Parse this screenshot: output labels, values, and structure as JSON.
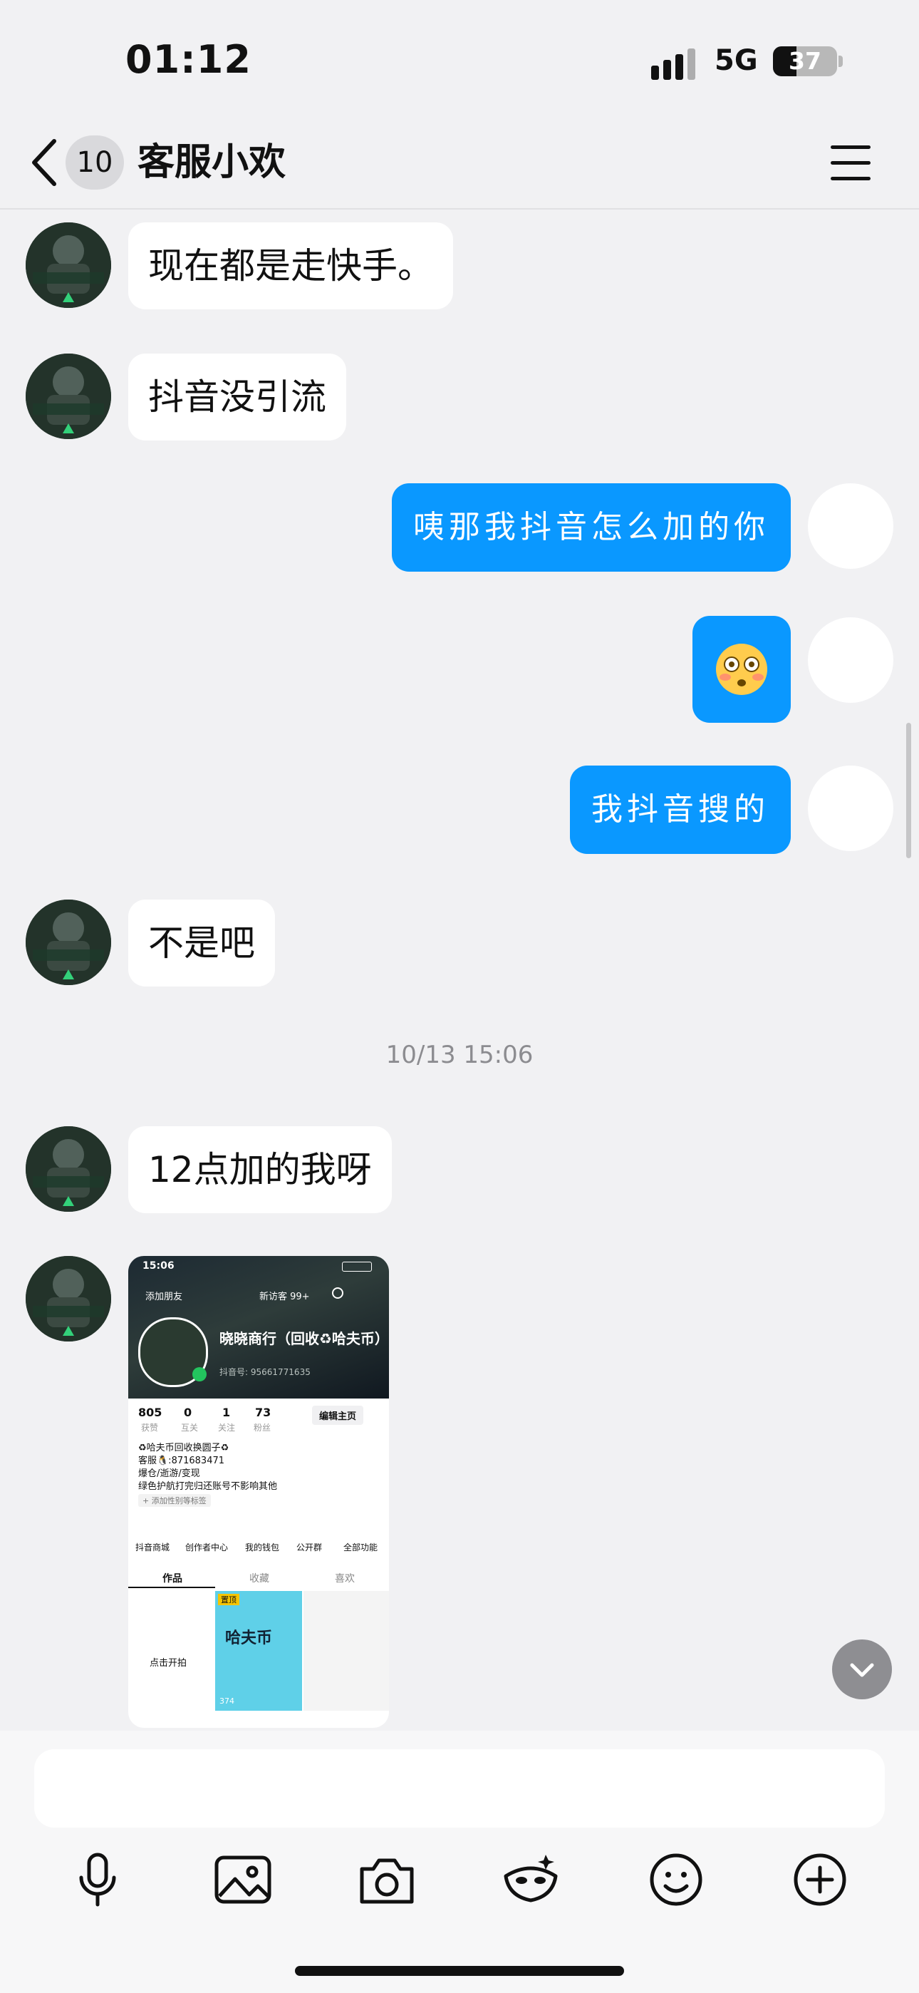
{
  "status_bar": {
    "time": "01:12",
    "network": "5G",
    "battery": "37",
    "battery_fraction": 0.37
  },
  "header": {
    "unread_count": "10",
    "title": "客服小欢"
  },
  "messages": [
    {
      "side": "in",
      "text": "现在都是走快手。"
    },
    {
      "side": "in",
      "text": "抖音没引流"
    },
    {
      "side": "out",
      "text": "咦那我抖音怎么加的你"
    },
    {
      "side": "out",
      "emoji": "😳"
    },
    {
      "side": "out",
      "text": "我抖音搜的"
    },
    {
      "side": "in",
      "text": "不是吧"
    },
    {
      "timestamp": "10/13 15:06"
    },
    {
      "side": "in",
      "text": "12点加的我呀"
    }
  ],
  "shared_screenshot": {
    "time": "15:06",
    "add_friend": "添加朋友",
    "visitors": "新访客 99+",
    "name": "晓晓商行（回收♻哈夫币）",
    "id_line": "抖音号: 95661771635",
    "stats": [
      {
        "value": "805",
        "label": "获赞"
      },
      {
        "value": "0",
        "label": "互关"
      },
      {
        "value": "1",
        "label": "关注"
      },
      {
        "value": "73",
        "label": "粉丝"
      }
    ],
    "edit_button": "编辑主页",
    "bio": [
      "♻哈夫币回收换圆子♻",
      "客服🐧:871683471",
      "爆仓/逝游/变现",
      "绿色护航打完归还账号不影响其他"
    ],
    "add_tag": "+ 添加性别等标签",
    "tools": [
      "抖音商城",
      "创作者中心",
      "我的钱包",
      "公开群",
      "全部功能"
    ],
    "tabs": [
      "作品",
      "收藏",
      "喜欢"
    ],
    "shoot": "点击开拍",
    "pinned": "置顶",
    "poster_main": "哈夫币",
    "views": "374"
  }
}
